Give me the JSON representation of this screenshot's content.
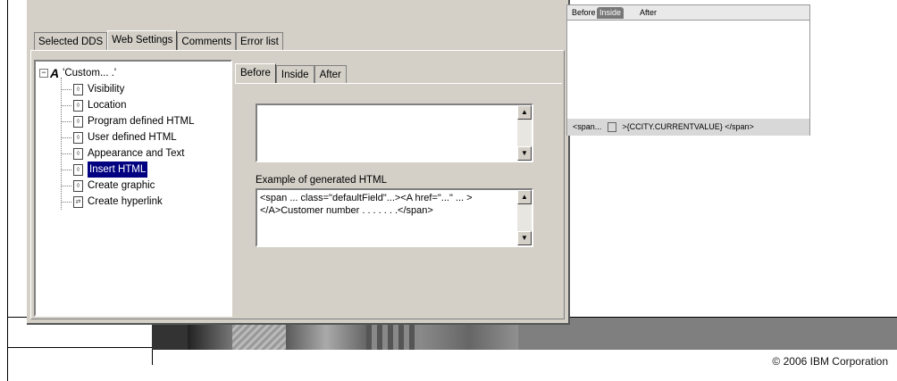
{
  "dialog": {
    "tabs": [
      "Selected DDS",
      "Web Settings",
      "Comments",
      "Error list"
    ],
    "active_tab": "Web Settings",
    "tree": {
      "root": "'Custom...   .'",
      "items": [
        "Visibility",
        "Location",
        "Program defined HTML",
        "User defined HTML",
        "Appearance and Text",
        "Insert HTML",
        "Create graphic",
        "Create hyperlink"
      ],
      "selected": "Insert HTML"
    },
    "subtabs": [
      "Before",
      "Inside",
      "After"
    ],
    "active_subtab": "Before",
    "editor_value": "",
    "example_label": "Example of generated HTML",
    "example_text": "<span ... class=\"defaultField\"...><A href=\"...\" ... ></A>Customer number . . . . . . .</span>"
  },
  "preview": {
    "tabs": [
      "Before",
      "Inside",
      "After"
    ],
    "active_tab": "Inside",
    "status_prefix": "<span...",
    "status_suffix": ">{CCITY.CURRENTVALUE} </span>"
  },
  "footer": {
    "copyright": "© 2006 IBM Corporation"
  }
}
